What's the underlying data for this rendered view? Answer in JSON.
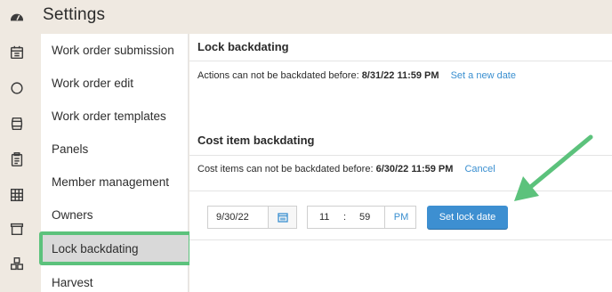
{
  "header": {
    "title": "Settings"
  },
  "rail": {
    "icons": [
      "dashboard-icon",
      "calendar-icon",
      "circle-icon",
      "barrel-icon",
      "clipboard-icon",
      "grid-icon",
      "archive-icon",
      "cubes-icon"
    ]
  },
  "menu": {
    "items": [
      {
        "label": "Work order submission"
      },
      {
        "label": "Work order edit"
      },
      {
        "label": "Work order templates"
      },
      {
        "label": "Panels"
      },
      {
        "label": "Member management"
      },
      {
        "label": "Owners"
      },
      {
        "label": "Lock backdating"
      },
      {
        "label": "Harvest"
      }
    ],
    "active_index": 6
  },
  "lock_backdating": {
    "title": "Lock backdating",
    "text": "Actions can not be backdated before:",
    "date": "8/31/22 11:59 PM",
    "link": "Set a new date"
  },
  "cost_item_backdating": {
    "title": "Cost item backdating",
    "text": "Cost items can not be backdated before:",
    "date": "6/30/22 11:59 PM",
    "link": "Cancel"
  },
  "form": {
    "date_value": "9/30/22",
    "hour": "11",
    "colon": ":",
    "minute": "59",
    "ampm": "PM",
    "submit_label": "Set lock date"
  },
  "colors": {
    "accent": "#3d8fd1",
    "link": "#3a8fd0",
    "highlight": "#5cc27c",
    "background": "#efe9e1"
  }
}
